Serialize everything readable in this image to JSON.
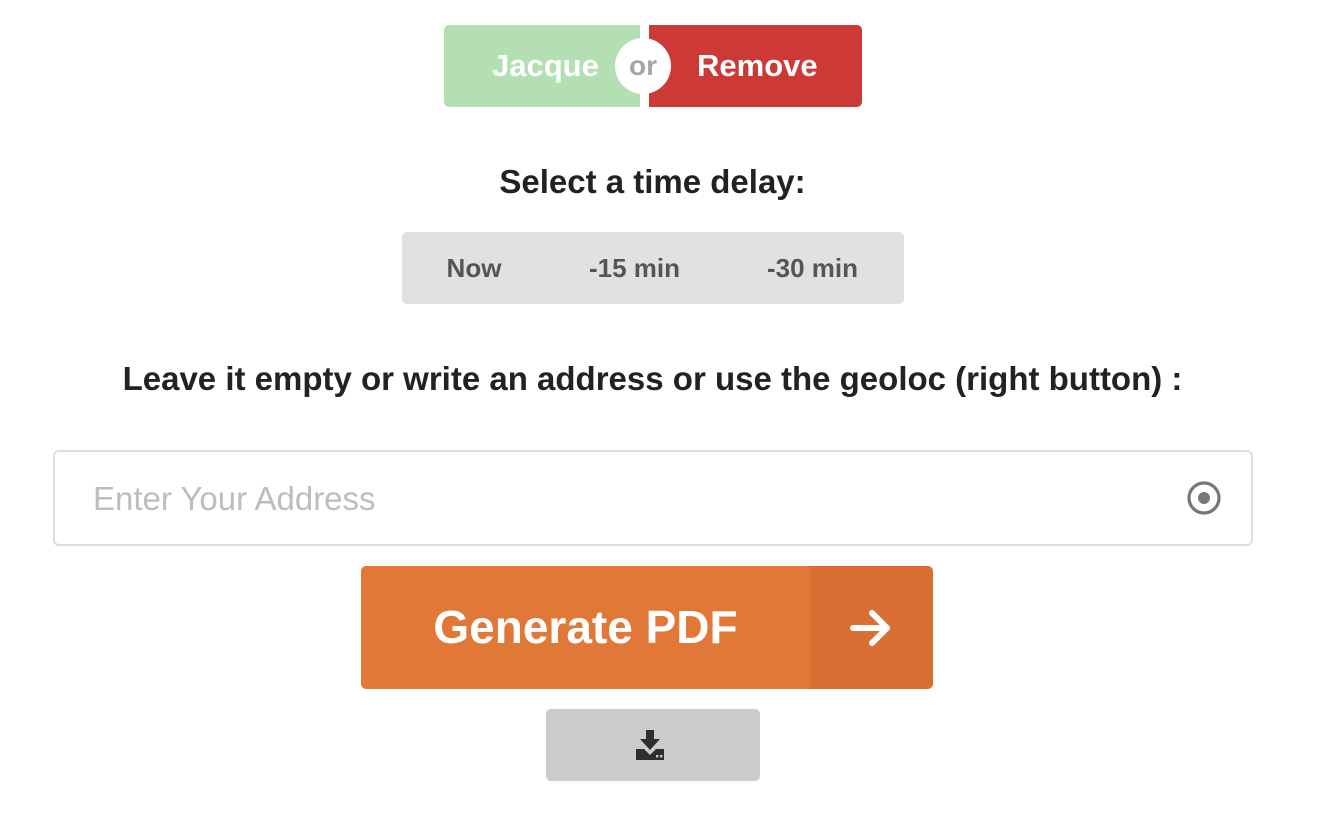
{
  "toggle": {
    "left_label": "Jacque",
    "or_label": "or",
    "right_label": "Remove",
    "colors": {
      "left": "#b3dfb3",
      "right": "#cd3a35"
    }
  },
  "delay": {
    "heading": "Select a time delay:",
    "options": [
      "Now",
      "-15 min",
      "-30 min"
    ]
  },
  "address": {
    "heading": "Leave it empty or write an address or use the geoloc (right button) :",
    "placeholder": "Enter Your Address",
    "value": "",
    "geoloc_icon": "dot-circle-icon"
  },
  "generate": {
    "label": "Generate PDF",
    "icon": "arrow-right-icon",
    "color": "#e27838"
  },
  "download": {
    "icon": "download-icon"
  }
}
